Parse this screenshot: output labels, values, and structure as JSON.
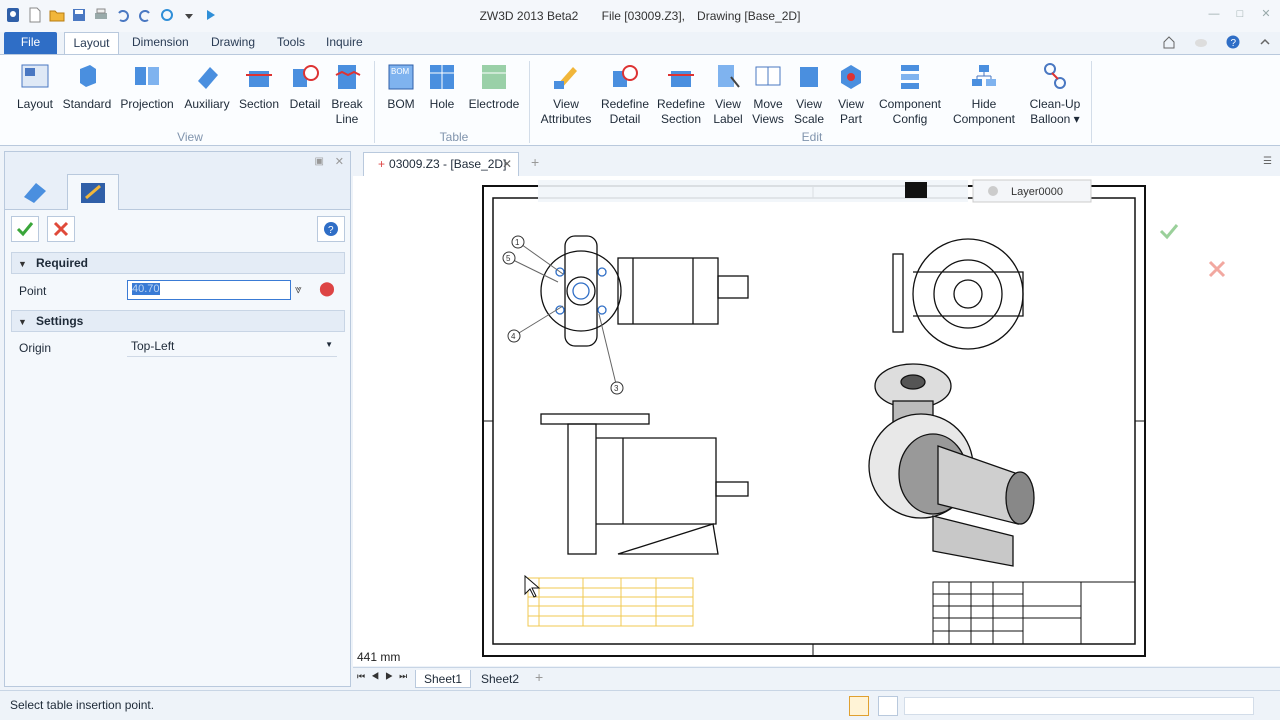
{
  "app": {
    "title": "ZW3D 2013 Beta2",
    "file": "File [03009.Z3],",
    "drawing": "Drawing [Base_2D]"
  },
  "tabs": [
    "File",
    "Layout",
    "Dimension",
    "Drawing",
    "Tools",
    "Inquire"
  ],
  "ribbon": {
    "view": [
      {
        "l1": "Layout",
        "l2": ""
      },
      {
        "l1": "Standard",
        "l2": ""
      },
      {
        "l1": "Projection",
        "l2": ""
      },
      {
        "l1": "Auxiliary",
        "l2": ""
      },
      {
        "l1": "Section",
        "l2": ""
      },
      {
        "l1": "Detail",
        "l2": ""
      },
      {
        "l1": "Break",
        "l2": "Line"
      }
    ],
    "view_group": "View",
    "table": [
      {
        "l1": "BOM",
        "l2": ""
      },
      {
        "l1": "Hole",
        "l2": ""
      },
      {
        "l1": "Electrode",
        "l2": ""
      }
    ],
    "table_group": "Table",
    "edit": [
      {
        "l1": "View",
        "l2": "Attributes"
      },
      {
        "l1": "Redefine",
        "l2": "Detail"
      },
      {
        "l1": "Redefine",
        "l2": "Section"
      },
      {
        "l1": "View",
        "l2": "Label"
      },
      {
        "l1": "Move",
        "l2": "Views"
      },
      {
        "l1": "View",
        "l2": "Scale"
      },
      {
        "l1": "View",
        "l2": "Part"
      },
      {
        "l1": "Component",
        "l2": "Config"
      },
      {
        "l1": "Hide",
        "l2": "Component"
      },
      {
        "l1": "Clean-Up",
        "l2": "Balloon ▾"
      }
    ],
    "edit_group": "Edit",
    "bom_badge": "BOM"
  },
  "panel": {
    "required": "Required",
    "point_label": "Point",
    "point_value": "40.70",
    "settings": "Settings",
    "origin_label": "Origin",
    "origin_value": "Top-Left"
  },
  "doc_tab": "03009.Z3 - [Base_2D]",
  "layer": "Layer0000",
  "scale_readout": "441 mm",
  "sheets": [
    "Sheet1",
    "Sheet2"
  ],
  "status": "Select table insertion point.",
  "balloons": [
    "1",
    "5",
    "4",
    "3"
  ],
  "colors": {
    "accent": "#2f6ec6",
    "table": "#f0c850",
    "ok": "#3aa63a",
    "cancel": "#e04a3a"
  }
}
